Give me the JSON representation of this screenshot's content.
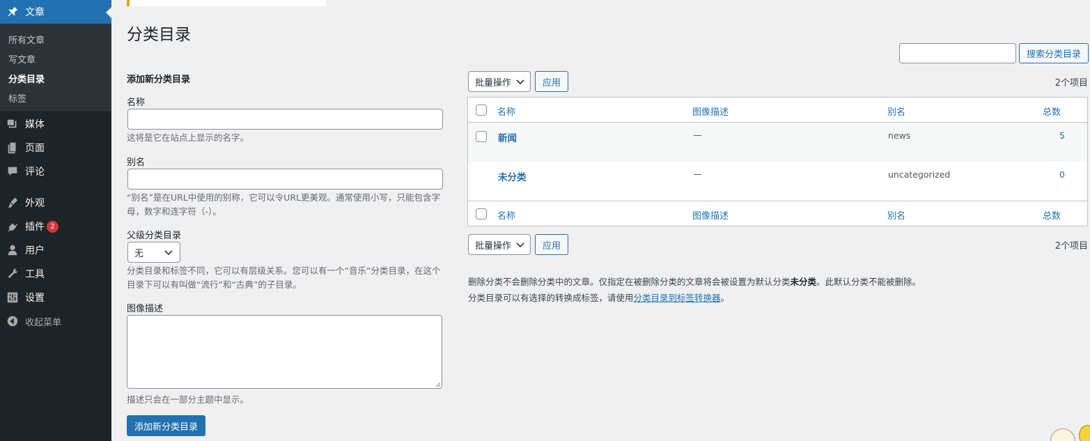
{
  "sidebar": {
    "posts_label": "文章",
    "submenu": [
      "所有文章",
      "写文章",
      "分类目录",
      "标签"
    ],
    "items": [
      {
        "label": "媒体",
        "icon": "media-icon"
      },
      {
        "label": "页面",
        "icon": "pages-icon"
      },
      {
        "label": "评论",
        "icon": "comments-icon"
      },
      {
        "label": "外观",
        "icon": "appearance-icon"
      },
      {
        "label": "插件",
        "icon": "plugins-icon",
        "badge": "2"
      },
      {
        "label": "用户",
        "icon": "users-icon"
      },
      {
        "label": "工具",
        "icon": "tools-icon"
      },
      {
        "label": "设置",
        "icon": "settings-icon"
      }
    ],
    "collapse_label": "收起菜单"
  },
  "page": {
    "title": "分类目录"
  },
  "form": {
    "heading": "添加新分类目录",
    "name_label": "名称",
    "name_value": "",
    "name_help": "这将是它在站点上显示的名字。",
    "slug_label": "别名",
    "slug_value": "",
    "slug_help": "“别名”是在URL中使用的别称，它可以令URL更美观。通常使用小写，只能包含字母，数字和连字符（-）。",
    "parent_label": "父级分类目录",
    "parent_value": "无",
    "parent_help": "分类目录和标签不同，它可以有层级关系。您可以有一个“音乐”分类目录，在这个目录下可以有叫做“流行”和“古典”的子目录。",
    "desc_label": "图像描述",
    "desc_value": "",
    "desc_help": "描述只会在一部分主题中显示。",
    "submit_label": "添加新分类目录"
  },
  "search": {
    "value": "",
    "button_label": "搜索分类目录"
  },
  "toolbar": {
    "bulk_label": "批量操作",
    "apply_label": "应用",
    "count_label": "2个项目"
  },
  "table": {
    "columns": [
      "名称",
      "图像描述",
      "别名",
      "总数"
    ],
    "rows": [
      {
        "name": "新闻",
        "description": "—",
        "slug": "news",
        "count": "5"
      },
      {
        "name": "未分类",
        "description": "—",
        "slug": "uncategorized",
        "count": "0"
      }
    ]
  },
  "notes": {
    "line1_pre": "删除分类不会删除分类中的文章。仅指定在被删除分类的文章将会被设置为默认分类",
    "line1_bold": "未分类",
    "line1_post": "。此默认分类不能被删除。",
    "line2_pre": "分类目录可以有选择的转换成标签，请使用",
    "line2_link": "分类目录到标签转换器",
    "line2_post": "。"
  },
  "colors": {
    "sidebar_bg": "#1d2327",
    "accent": "#2271b1",
    "badge": "#d63638"
  }
}
